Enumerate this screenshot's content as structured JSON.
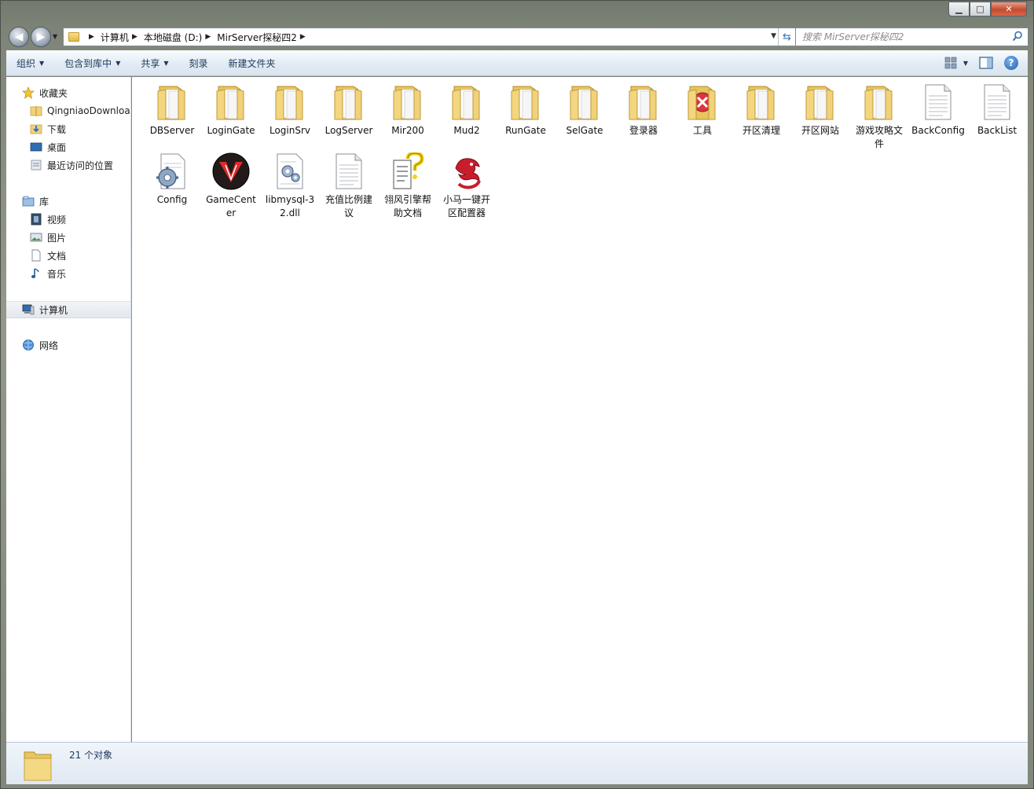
{
  "window": {
    "caption_buttons": {
      "minimize": "▁",
      "maximize": "□",
      "close": "✕"
    }
  },
  "address_bar": {
    "crumbs": [
      "计算机",
      "本地磁盘 (D:)",
      "MirServer探秘四2"
    ]
  },
  "search": {
    "placeholder": "搜索 MirServer探秘四2"
  },
  "toolbar": {
    "organize": "组织",
    "include_in_library": "包含到库中",
    "share": "共享",
    "burn": "刻录",
    "new_folder": "新建文件夹"
  },
  "nav_pane": {
    "favorites": {
      "label": "收藏夹",
      "items": [
        "QingniaoDownload",
        "下载",
        "桌面",
        "最近访问的位置"
      ]
    },
    "libraries": {
      "label": "库",
      "items": [
        "视频",
        "图片",
        "文档",
        "音乐"
      ]
    },
    "computer": "计算机",
    "network": "网络"
  },
  "files": [
    {
      "name": "DBServer",
      "type": "folder"
    },
    {
      "name": "LoginGate",
      "type": "folder"
    },
    {
      "name": "LoginSrv",
      "type": "folder"
    },
    {
      "name": "LogServer",
      "type": "folder"
    },
    {
      "name": "Mir200",
      "type": "folder"
    },
    {
      "name": "Mud2",
      "type": "folder"
    },
    {
      "name": "RunGate",
      "type": "folder"
    },
    {
      "name": "SelGate",
      "type": "folder"
    },
    {
      "name": "登录器",
      "type": "folder"
    },
    {
      "name": "工具",
      "type": "folder-red"
    },
    {
      "name": "开区清理",
      "type": "folder"
    },
    {
      "name": "开区网站",
      "type": "folder"
    },
    {
      "name": "游戏攻略文件",
      "type": "folder"
    },
    {
      "name": "BackConfig",
      "type": "document"
    },
    {
      "name": "BackList",
      "type": "document"
    },
    {
      "name": "Config",
      "type": "config"
    },
    {
      "name": "GameCenter",
      "type": "gamecenter"
    },
    {
      "name": "libmysql-32.dll",
      "type": "dll"
    },
    {
      "name": "充值比例建议",
      "type": "document"
    },
    {
      "name": "翎风引擎帮助文档",
      "type": "help"
    },
    {
      "name": "小马一键开区配置器",
      "type": "dragon"
    }
  ],
  "status": {
    "count_text": "21 个对象"
  },
  "colors": {
    "folder": "#f1d27a",
    "command_text": "#1e395b",
    "close_red": "#c44a2a"
  }
}
